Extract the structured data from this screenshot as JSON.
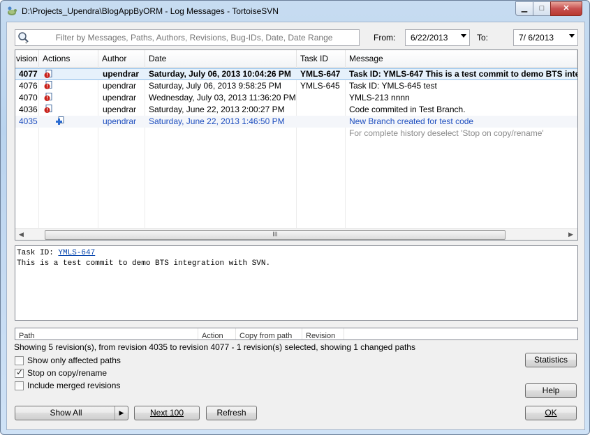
{
  "window": {
    "title": "D:\\Projects_Upendra\\BlogAppByORM - Log Messages - TortoiseSVN",
    "min_glyph": "▁",
    "max_glyph": "□",
    "close_glyph": "✕"
  },
  "filter": {
    "placeholder": "Filter by Messages, Paths, Authors, Revisions, Bug-IDs, Date, Date Range",
    "from_label": "From:",
    "from_value": "6/22/2013",
    "to_label": "To:",
    "to_value": "7/  6/2013"
  },
  "log": {
    "columns": [
      "vision",
      "Actions",
      "Author",
      "Date",
      "Task ID",
      "Message"
    ],
    "rows": [
      {
        "revision": "4077",
        "author": "upendrar",
        "date": "Saturday, July 06, 2013 10:04:26 PM",
        "task_id": "YMLS-647",
        "message": "Task ID: YMLS-647 This is a test commit to demo BTS inte",
        "action_icon": "modified-icon"
      },
      {
        "revision": "4076",
        "author": "upendrar",
        "date": "Saturday, July 06, 2013 9:58:25 PM",
        "task_id": "YMLS-645",
        "message": "Task ID: YMLS-645 test",
        "action_icon": "modified-icon"
      },
      {
        "revision": "4070",
        "author": "upendrar",
        "date": "Wednesday, July 03, 2013 11:36:20 PM",
        "task_id": "",
        "message": "YMLS-213 nnnn",
        "action_icon": "modified-icon"
      },
      {
        "revision": "4036",
        "author": "upendrar",
        "date": "Saturday, June 22, 2013 2:00:27 PM",
        "task_id": "",
        "message": "Code commited in Test Branch.",
        "action_icon": "modified-icon"
      },
      {
        "revision": "4035",
        "author": "upendrar",
        "date": "Saturday, June 22, 2013 1:46:50 PM",
        "task_id": "",
        "message": "New Branch created for test code",
        "action_icon": "added-icon"
      }
    ],
    "hint": "For complete history deselect 'Stop on copy/rename'",
    "scroll_grip": "III"
  },
  "message_pane": {
    "line1_prefix": "Task ID: ",
    "line1_link": "YMLS-647",
    "line2": "This is a test commit to demo BTS integration with SVN."
  },
  "paths_pane": {
    "columns": [
      "Path",
      "Action",
      "Copy from path",
      "Revision"
    ]
  },
  "status_text": "Showing 5 revision(s), from revision 4035 to revision 4077 - 1 revision(s) selected, showing 1 changed paths",
  "options": {
    "only_affected": {
      "label": "Show only affected paths",
      "checked": false
    },
    "stop_on_copy": {
      "label": "Stop on copy/rename",
      "checked": true
    },
    "include_merged": {
      "label": "Include merged revisions",
      "checked": false
    }
  },
  "buttons": {
    "show_all": "Show All",
    "next_100": "Next 100",
    "refresh": "Refresh",
    "statistics": "Statistics",
    "help": "Help",
    "ok": "OK"
  },
  "colors": {
    "accent_blue": "#1f4fbf",
    "selection": "#e6f1fb",
    "hint_gray": "#8a8a8a"
  }
}
